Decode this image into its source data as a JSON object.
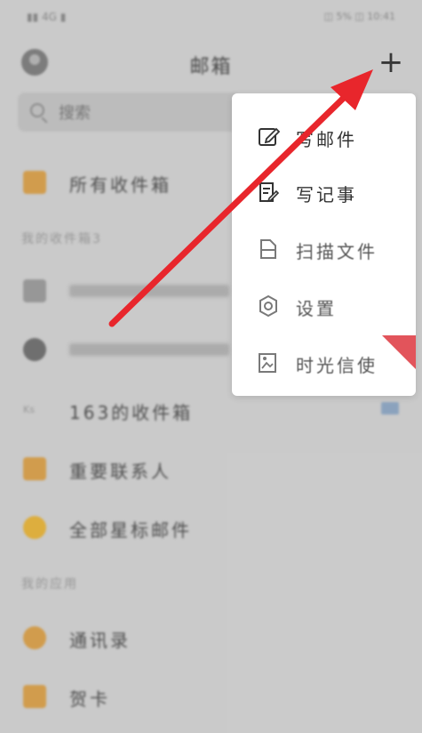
{
  "status": {
    "left": "▮▮ 4G ▮",
    "right": "◫ 5% ◫ 10:41"
  },
  "header": {
    "title": "邮箱"
  },
  "search": {
    "placeholder": "搜索"
  },
  "list": {
    "all_inbox": "所有收件箱",
    "section_my_inboxes": "我的收件箱3",
    "inbox_163": "163的收件箱",
    "important_contacts": "重要联系人",
    "starred": "全部星标邮件",
    "section_my_apps": "我的应用",
    "contacts": "通讯录",
    "cards": "贺卡"
  },
  "menu": {
    "write_mail": "写邮件",
    "write_note": "写记事",
    "scan_file": "扫描文件",
    "settings": "设置",
    "time_mail": "时光信使"
  },
  "colors": {
    "arrow": "#e8262c",
    "menu_bg": "#ffffff",
    "overlay": "#d2d2d2"
  }
}
